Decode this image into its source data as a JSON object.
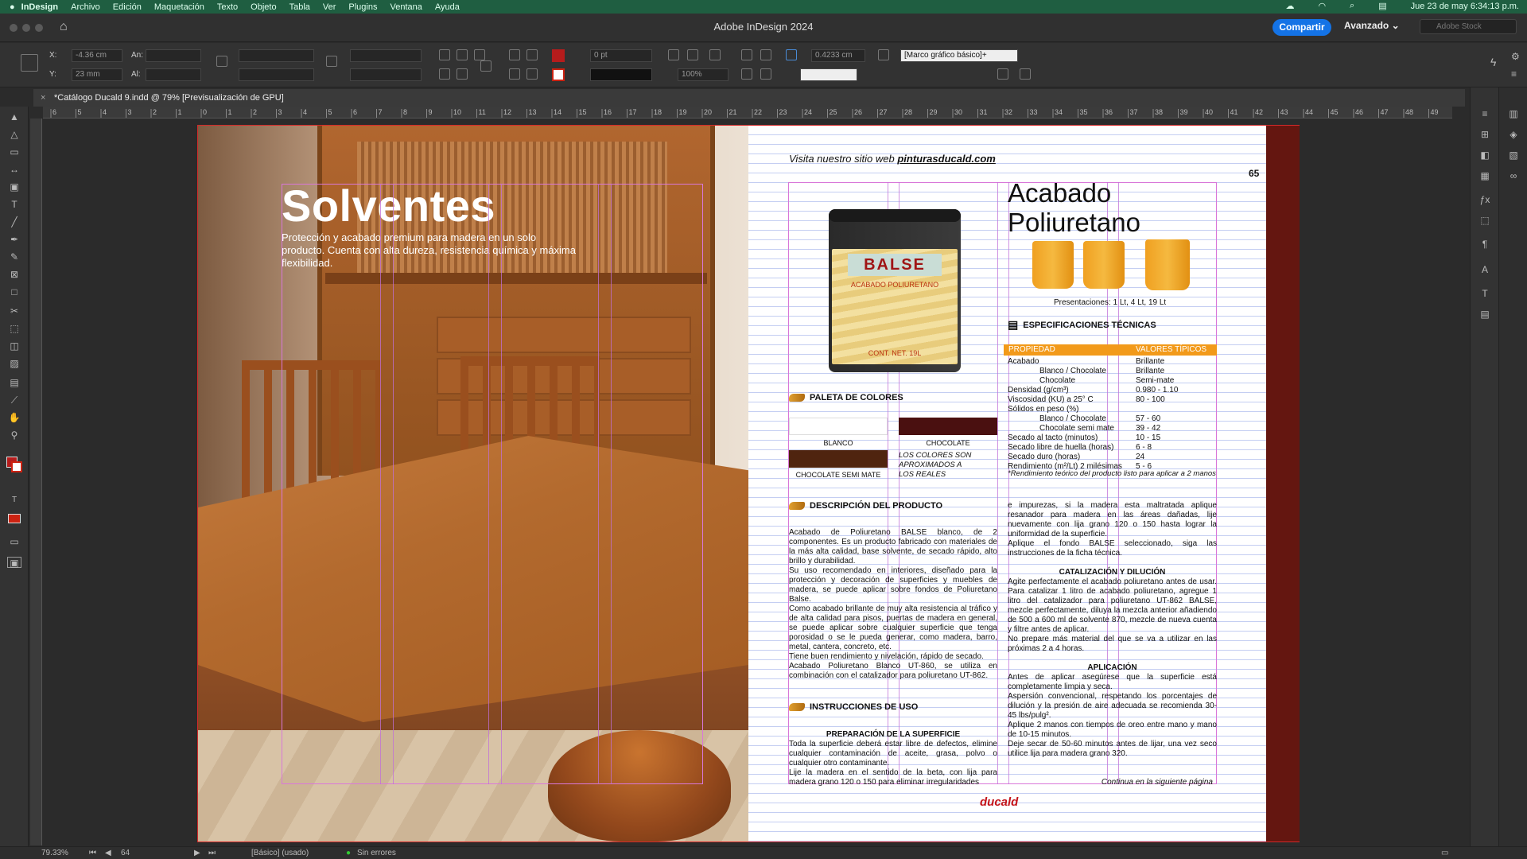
{
  "menubar": {
    "app": "InDesign",
    "items": [
      "Archivo",
      "Edición",
      "Maquetación",
      "Texto",
      "Objeto",
      "Tabla",
      "Ver",
      "Plugins",
      "Ventana",
      "Ayuda"
    ],
    "datetime": "Jue 23 de may  6:34:13 p.m."
  },
  "titlebar": {
    "title": "Adobe InDesign 2024",
    "share": "Compartir",
    "workspace": "Avanzado",
    "stock_placeholder": "Adobe Stock"
  },
  "control": {
    "x_label": "X:",
    "x_value": "-4.36 cm",
    "y_label": "Y:",
    "y_value": "23 mm",
    "w_label": "An:",
    "h_label": "Al:",
    "stroke": "0 pt",
    "scale": "100%",
    "offset": "0.4233 cm",
    "frame_style": "[Marco gráfico básico]+"
  },
  "doc_tab": "*Catálogo Ducald 9.indd @ 79% [Previsualización de GPU]",
  "ruler": [
    "6",
    "5",
    "4",
    "3",
    "2",
    "1",
    "0",
    "1",
    "2",
    "3",
    "4",
    "5",
    "6",
    "7",
    "8",
    "9",
    "10",
    "11",
    "12",
    "13",
    "14",
    "15",
    "16",
    "17",
    "18",
    "19",
    "20",
    "21",
    "22",
    "23",
    "24",
    "25",
    "26",
    "27",
    "28",
    "29",
    "30",
    "31",
    "32",
    "33",
    "34",
    "35",
    "36",
    "37",
    "38",
    "39",
    "40",
    "41",
    "42",
    "43",
    "44",
    "45",
    "46",
    "47",
    "48",
    "49"
  ],
  "left_page": {
    "title": "Solventes",
    "subtitle": "Protección y acabado premium para madera en un solo producto. Cuenta con alta dureza, resistencia química y máxima flexibilidad."
  },
  "right_page": {
    "website_prefix": "Visita nuestro sitio web ",
    "website": "pinturasducald.com",
    "page_number": "65",
    "product_title": "Acabado Poliuretano",
    "can_brand": "BALSE",
    "can_sub": "ACABADO POLIURETANO",
    "can_net": "CONT. NET. 19L",
    "presentations": "Presentaciones: 1 Lt, 4 Lt, 19 Lt",
    "spec_heading": "ESPECIFICACIONES TÉCNICAS",
    "spec_col1": "PROPIEDAD",
    "spec_col2": "VALORES TÍPICOS",
    "specs": [
      {
        "p": "Acabado",
        "v": "Brillante"
      },
      {
        "p": "Blanco / Chocolate",
        "v": "Brillante",
        "indent": true
      },
      {
        "p": "Chocolate",
        "v": "Semi-mate",
        "indent": true
      },
      {
        "p": "Densidad (g/cm³)",
        "v": "0.980 - 1.10"
      },
      {
        "p": "Viscosidad (KU) a 25° C",
        "v": "80 - 100"
      },
      {
        "p": "Sólidos en peso (%)",
        "v": ""
      },
      {
        "p": "Blanco / Chocolate",
        "v": "57 - 60",
        "indent": true
      },
      {
        "p": "Chocolate semi mate",
        "v": "39 - 42",
        "indent": true
      },
      {
        "p": "Secado al tacto (minutos)",
        "v": "10 - 15"
      },
      {
        "p": "Secado libre de huella (horas)",
        "v": "6 - 8"
      },
      {
        "p": "Secado duro (horas)",
        "v": "24"
      },
      {
        "p": "Rendimiento (m²/Lt) 2 milésimas",
        "v": "5 - 6"
      }
    ],
    "spec_note": "*Rendimiento teórico del producto listo para aplicar a 2 manos",
    "palette_heading": "PALETA DE COLORES",
    "swatches": {
      "blanco": "BLANCO",
      "chocolate": "CHOCOLATE",
      "semi": "CHOCOLATE SEMI MATE",
      "chocolate_color": "#4a1010",
      "semi_color": "#4f240f"
    },
    "approx": [
      "LOS COLORES SON",
      "APROXIMADOS A",
      "LOS REALES"
    ],
    "desc_heading": "DESCRIPCIÓN DEL PRODUCTO",
    "desc": "Acabado de Poliuretano BALSE blanco, de 2 componentes. Es un producto fabricado con materiales de la más alta calidad, base solvente, de secado rápido, alto brillo y durabilidad.\nSu uso recomendado en interiores, diseñado para la protección y decoración de superficies y muebles de madera, se puede aplicar sobre fondos de Poliuretano Balse.\nComo acabado brillante de muy alta resistencia al tráfico y de alta calidad para pisos, puertas de madera en general, se puede aplicar sobre cualquier superficie que tenga porosidad o se le pueda generar, como madera, barro, metal, cantera, concreto, etc.\nTiene buen rendimiento y nivelación, rápido de secado.\nAcabado Poliuretano Blanco UT-860, se utiliza en combinación con el catalizador para poliuretano UT-862.",
    "instr_heading": "INSTRUCCIONES DE USO",
    "prep_heading": "PREPARACIÓN DE LA SUPERFICIE",
    "prep": "Toda la superficie deberá estar libre de defectos, elimine cualquier contaminación de aceite, grasa, polvo o cualquier otro contaminante.\nLije la madera en el sentido de la beta, con lija para madera grano 120 o 150 para eliminar irregularidades",
    "prep_cont": "e impurezas, si la madera esta maltratada aplique resanador para madera en las áreas dañadas, lije nuevamente con lija grano 120 o 150 hasta lograr la uniformidad de la superficie.\nAplique el fondo BALSE seleccionado, siga las instrucciones de la ficha técnica.",
    "cat_heading": "CATALIZACIÓN Y DILUCIÓN",
    "cat": "Agite perfectamente el acabado poliuretano antes de usar. Para catalizar 1 litro de acabado poliuretano, agregue 1 litro del catalizador para poliuretano UT-862 BALSE, mezcle perfectamente, diluya la mezcla anterior añadiendo de 500 a 600 ml de solvente 870, mezcle de nueva cuenta y filtre antes de aplicar.\nNo prepare más material del que se va a utilizar en las próximas 2 a 4 horas.",
    "app_heading": "APLICACIÓN",
    "app": "Antes de aplicar asegúrese que la superficie está completamente limpia y seca.\nAspersión convencional, respetando los porcentajes de dilución y la presión de aire adecuada se recomienda 30-45 lbs/pulg².\nAplique 2 manos con tiempos de oreo entre mano y mano de 10-15 minutos.\nDeje secar de 50-60 minutos antes de lijar, una vez seco utilice lija para madera grano 320.",
    "continue": "Continua en la siguiente página",
    "logo": "ducald"
  },
  "status": {
    "zoom": "79.33%",
    "page": "64",
    "style": "[Básico] (usado)",
    "errors": "Sin errores"
  }
}
